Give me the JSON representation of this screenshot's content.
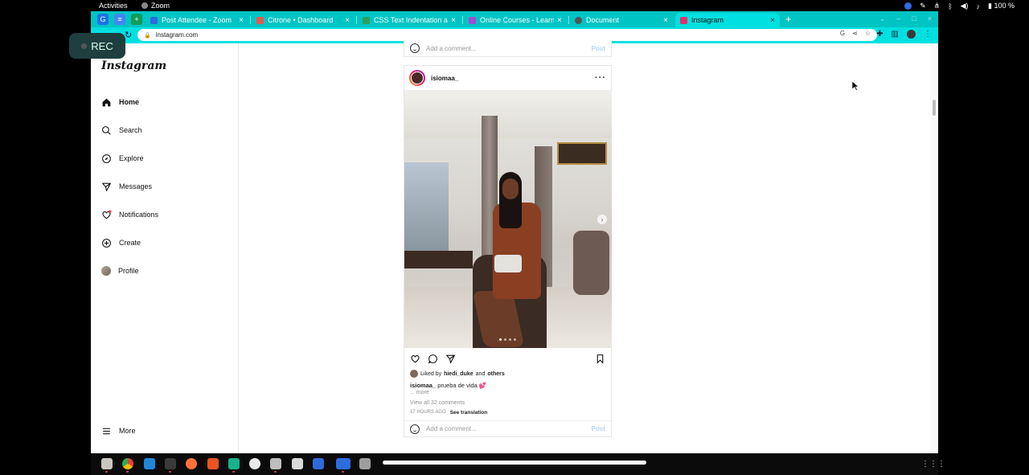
{
  "system": {
    "activities": "Activities",
    "app_name": "Zoom",
    "battery": "100 %"
  },
  "rec_label": "REC",
  "tabs": [
    {
      "title": "Post Attendee - Zoom",
      "color": "#2d6cdf"
    },
    {
      "title": "Citrone • Dashboard",
      "color": "#e05a4c"
    },
    {
      "title": "CSS Text Indentation and",
      "color": "#2e9e5b"
    },
    {
      "title": "Online Courses - Learn An",
      "color": "#a24bd6"
    },
    {
      "title": "Document",
      "color": "#555555"
    },
    {
      "title": "Instagram",
      "color": "#e1306c"
    }
  ],
  "address": "instagram.com",
  "sidebar": {
    "logo": "Instagram",
    "items": [
      {
        "label": "Home"
      },
      {
        "label": "Search"
      },
      {
        "label": "Explore"
      },
      {
        "label": "Messages"
      },
      {
        "label": "Notifications"
      },
      {
        "label": "Create"
      },
      {
        "label": "Profile"
      }
    ],
    "more": "More"
  },
  "prev_post": {
    "comment_placeholder": "Add a comment...",
    "post_label": "Post"
  },
  "post": {
    "username": "isiomaa_",
    "liked_by_prefix": "Liked by",
    "liked_by_user": "hiedi_duke",
    "liked_by_and": "and",
    "liked_by_others": "others",
    "caption_user": "isiomaa_",
    "caption_text": "prueba de vida 💕",
    "more": "... more",
    "view_comments": "View all 32 comments",
    "time": "17 HOURS AGO",
    "see_translation": "See translation",
    "comment_placeholder": "Add a comment...",
    "post_label": "Post",
    "carousel_count": 4,
    "carousel_active": 1
  },
  "colors": {
    "tab_strip": "#00c4c4",
    "toolbar": "#00e0e0"
  }
}
